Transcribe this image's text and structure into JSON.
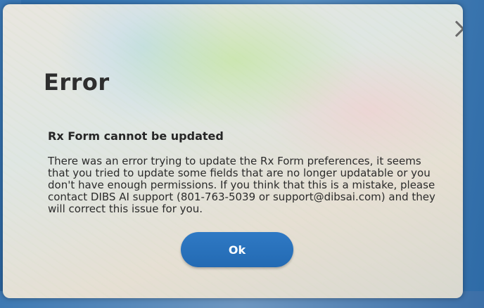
{
  "dialog": {
    "title": "Error",
    "subtitle": "Rx Form cannot be updated",
    "message": "There was an error trying to update the Rx Form preferences, it seems that you tried to update some fields that are no longer updatable or you don't have enough permissions. If you think that this is a mistake, please contact DIBS AI support (801-763-5039 or support@dibsai.com) and they will correct this issue for you.",
    "ok_label": "Ok",
    "close_icon": "close-icon"
  },
  "colors": {
    "button": "#2a71bc",
    "button_text": "#ffffff",
    "dialog_bg": "#e6e3dc",
    "text": "#2b2b2b",
    "close": "#6b6b6b"
  }
}
